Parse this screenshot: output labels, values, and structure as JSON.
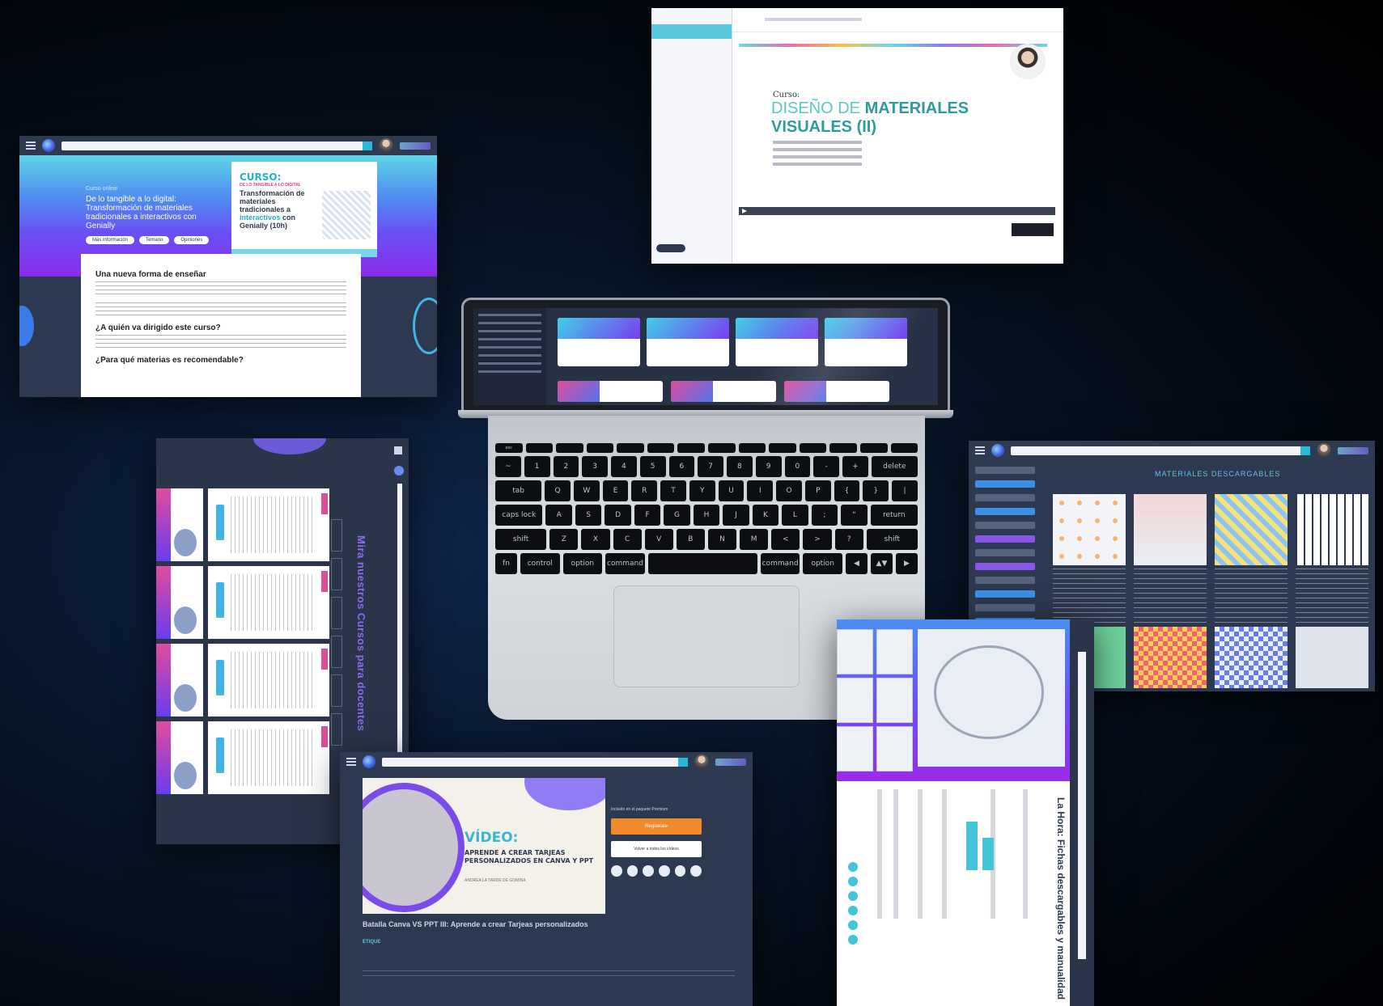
{
  "screen_a": {
    "hero_kicker": "Curso online",
    "hero_title": "De lo tangible a lo digital: Transformación de materiales tradicionales a interactivos con Genially",
    "buttons": [
      "Más información",
      "Temario",
      "Opiniones"
    ],
    "banner_curso": "CURSO:",
    "banner_sub": "DE LO TANGIBLE A LO DIGITAL",
    "banner_title_1": "Transformación de materiales tradicionales a ",
    "banner_title_hl": "interactivos",
    "banner_title_2": " con Genially",
    "banner_hours": "(10h)",
    "h1": "Una nueva forma de enseñar",
    "h2": "¿A quién va dirigido este curso?",
    "h3": "¿Para qué materias es recomendable?"
  },
  "screen_b": {
    "kicker": "Curso:",
    "title_light": "DISEÑO DE ",
    "title_bold_1": "MATERIALES",
    "title_bold_2": "VISUALES (II)"
  },
  "screen_c": {
    "vertical_title": "Mira nuestros Cursos para docentes"
  },
  "screen_d": {
    "title": "MATERIALES DESCARGABLES"
  },
  "screen_e": {
    "thumb_title": "VÍDEO:",
    "thumb_subtitle": "APRENDE A CREAR TARJEAS PERSONALIZADOS EN CANVA Y PPT",
    "thumb_author": "ANDREA LA TARDE DE GOMINA",
    "title": "Batalla Canva VS PPT III: Aprende a crear Tarjeas personalizados",
    "tag": "ETIQUE",
    "panel_label": "Incluido en el paquete Premium",
    "btn_primary": "Regístrate",
    "btn_secondary": "Volver a todos los vídeos"
  },
  "screen_f": {
    "vertical_title": "La Hora: Fichas descargables y manualidad"
  },
  "keyboard": {
    "row1": [
      "~",
      "1",
      "2",
      "3",
      "4",
      "5",
      "6",
      "7",
      "8",
      "9",
      "0",
      "-",
      "+",
      "delete"
    ],
    "row2": [
      "tab",
      "Q",
      "W",
      "E",
      "R",
      "T",
      "Y",
      "U",
      "I",
      "O",
      "P",
      "{",
      "}",
      "|"
    ],
    "row3": [
      "caps lock",
      "A",
      "S",
      "D",
      "F",
      "G",
      "H",
      "J",
      "K",
      "L",
      ";",
      "\"",
      "return"
    ],
    "row4": [
      "shift",
      "Z",
      "X",
      "C",
      "V",
      "B",
      "N",
      "M",
      "<",
      ">",
      "?",
      "shift"
    ],
    "row5": [
      "fn",
      "control",
      "option",
      "command",
      "",
      "command",
      "option",
      "◀",
      "▲▼",
      "▶"
    ]
  }
}
